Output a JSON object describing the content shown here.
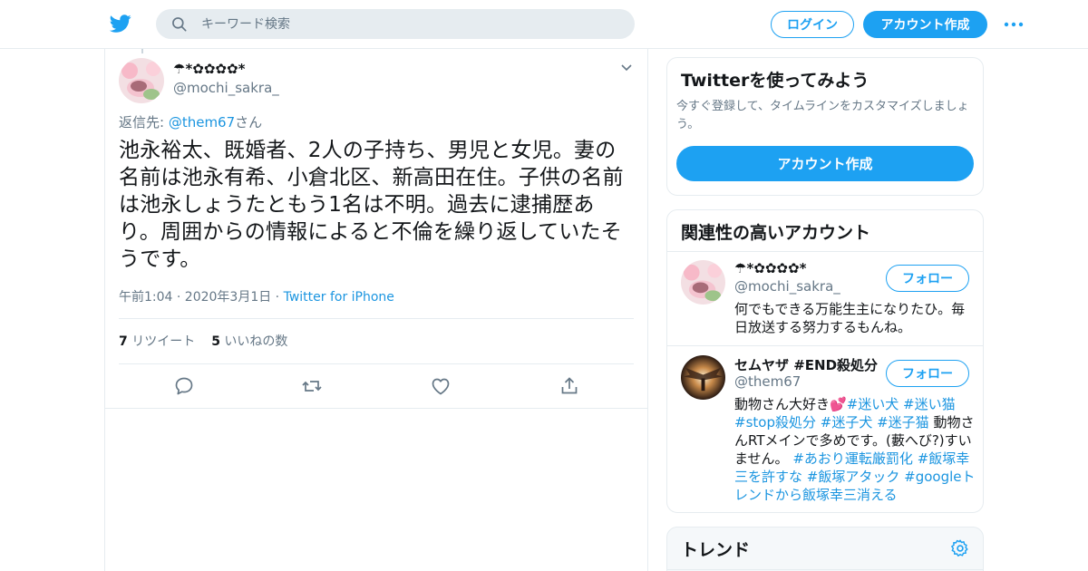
{
  "header": {
    "logo_icon": "twitter-bird-icon",
    "search_placeholder": "キーワード検索",
    "login_label": "ログイン",
    "signup_label": "アカウント作成",
    "more_icon": "more-dots-icon",
    "brand_color": "#1da1f2"
  },
  "tweet": {
    "display_name": "☂*✿✿✿✿*",
    "handle": "@mochi_sakra_",
    "reply_prefix": "返信先: ",
    "reply_mention": "@them67",
    "reply_suffix": "さん",
    "text": "池永裕太、既婚者、2人の子持ち、男児と女児。妻の名前は池永有希、小倉北区、新高田在住。子供の名前は池永しょうたともう1名は不明。過去に逮捕歴あり。周囲からの情報によると不倫を繰り返していたそうです。",
    "timestamp": "午前1:04 · 2020年3月1日",
    "meta_separator": " · ",
    "source": "Twitter for iPhone",
    "retweet_count": "7",
    "retweet_label": "リツイート",
    "like_count": "5",
    "like_label": "いいねの数",
    "actions": [
      "reply-icon",
      "retweet-icon",
      "like-icon",
      "share-icon"
    ]
  },
  "sidebar": {
    "try_card": {
      "title": "Twitterを使ってみよう",
      "description": "今すぐ登録して、タイムラインをカスタマイズしましょう。",
      "button_label": "アカウント作成"
    },
    "accounts_card": {
      "title": "関連性の高いアカウント",
      "follow_label": "フォロー",
      "accounts": [
        {
          "name": "☂*✿✿✿✿*",
          "handle": "@mochi_sakra_",
          "bio": "何でもできる万能生主になりたひ。毎日放送する努力するもんね。"
        },
        {
          "name": "セムヤザ #END殺処分",
          "handle": "@them67",
          "bio_parts": [
            "動物さん大好き💕",
            "#迷い犬",
            "#迷い猫",
            "#stop殺処分",
            "#迷子犬",
            "#迷子猫",
            "動物さんRTメインで多めです。(藪へび?)すいません。",
            "#あおり運転厳罰化",
            "#飯塚幸三を許すな",
            "#飯塚アタック",
            "#googleトレンドから飯塚幸三消える"
          ]
        }
      ]
    },
    "trends_card": {
      "title": "トレンド",
      "settings_icon": "gear-icon"
    }
  }
}
